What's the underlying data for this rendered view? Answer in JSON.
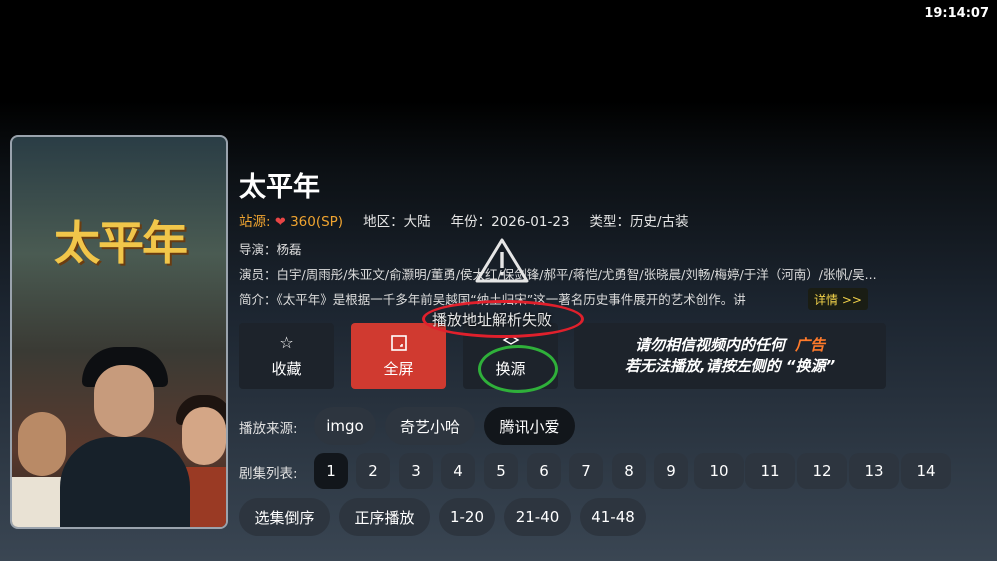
{
  "status_bar": {
    "time": "19:14:07"
  },
  "poster": {
    "title": "太平年"
  },
  "show": {
    "title": "太平年",
    "source_label": "站源:",
    "source_value": "360(SP)",
    "region": "地区：大陆",
    "year": "年份：2026-01-23",
    "genre": "类型：历史/古装",
    "director": "导演：杨磊",
    "cast": "演员：白宇/周雨彤/朱亚文/俞灏明/董勇/侯大红/保剑锋/郝平/蒋恺/尤勇智/张晓晨/刘畅/梅婷/于洋（河南）/张帆/吴...",
    "intro": "简介：《太平年》是根据一千多年前吴越国“纳土归宋”这一著名历史事件展开的艺术创作。讲",
    "detail_button": "详情 >>"
  },
  "overlay": {
    "error_text": "播放地址解析失败"
  },
  "actions": {
    "favorite": "收藏",
    "fullscreen": "全屏",
    "switch_source": "换源",
    "notice_line1": "请勿相信视频内的任何",
    "notice_ad": "广告",
    "notice_line2": "若无法播放,请按左侧的 “换源”"
  },
  "sources": {
    "label": "播放来源:",
    "items": [
      "imgo",
      "奇艺小哈",
      "腾讯小爱"
    ],
    "selected_index": 2
  },
  "episodes": {
    "label": "剧集列表:",
    "items": [
      "1",
      "2",
      "3",
      "4",
      "5",
      "6",
      "7",
      "8",
      "9",
      "10",
      "11",
      "12",
      "13",
      "14"
    ],
    "selected_index": 0
  },
  "episode_controls": {
    "items": [
      "选集倒序",
      "正序播放",
      "1-20",
      "21-40",
      "41-48"
    ]
  },
  "colors": {
    "accent_orange": "#f0a430",
    "fullscreen_red": "#d03a30",
    "annotation_red": "#e0202c",
    "annotation_green": "#2fb03a",
    "detail_yellow": "#f3d34a"
  }
}
